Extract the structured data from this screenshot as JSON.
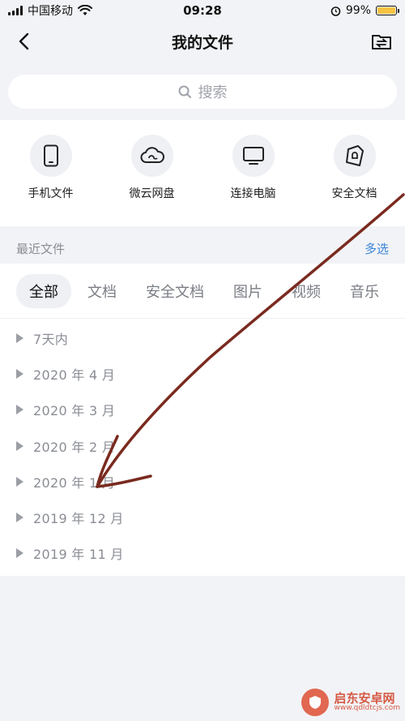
{
  "status_bar": {
    "carrier": "中国移动",
    "time": "09:28",
    "battery": "99%",
    "battery_level": 0.99
  },
  "nav": {
    "title": "我的文件",
    "back_icon": "back-chevron-icon",
    "right_icon": "file-transfer-icon"
  },
  "search": {
    "placeholder": "搜索"
  },
  "quick_actions": [
    {
      "label": "手机文件",
      "icon": "phone-icon"
    },
    {
      "label": "微云网盘",
      "icon": "cloud-icon"
    },
    {
      "label": "连接电脑",
      "icon": "monitor-icon"
    },
    {
      "label": "安全文档",
      "icon": "secure-doc-icon"
    }
  ],
  "recent": {
    "title": "最近文件",
    "multi_select": "多选"
  },
  "tabs": [
    {
      "label": "全部",
      "active": true
    },
    {
      "label": "文档",
      "active": false
    },
    {
      "label": "安全文档",
      "active": false
    },
    {
      "label": "图片",
      "active": false
    },
    {
      "label": "视频",
      "active": false
    },
    {
      "label": "音乐",
      "active": false
    }
  ],
  "groups": [
    {
      "label": "7天内"
    },
    {
      "label": "2020 年 4 月"
    },
    {
      "label": "2020 年 3 月"
    },
    {
      "label": "2020 年 2 月"
    },
    {
      "label": "2020 年 1 月"
    },
    {
      "label": "2019 年 12 月"
    },
    {
      "label": "2019 年 11 月"
    }
  ],
  "annotation": {
    "arrow_color": "#7a2a1f"
  },
  "watermark": {
    "title": "启东安卓网",
    "url": "www.qdldtcjs.com",
    "logo_color": "#e0583f"
  }
}
